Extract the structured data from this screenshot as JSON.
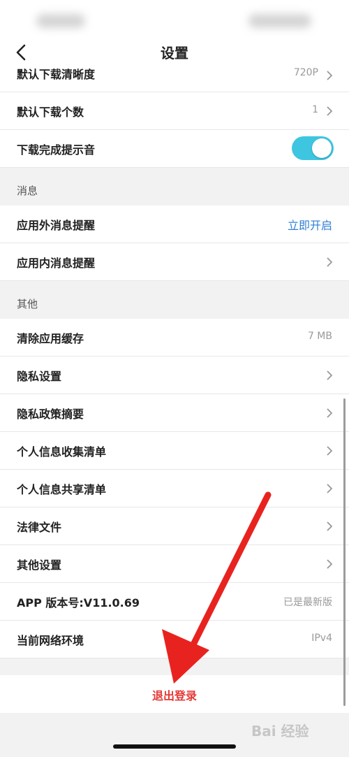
{
  "nav": {
    "title": "设置"
  },
  "download": {
    "clip_label": "默认下载清晰度",
    "clip_value": "720P",
    "count_label": "默认下载个数",
    "count_value": "1",
    "sound_label": "下载完成提示音",
    "sound_on": true
  },
  "messages": {
    "header": "消息",
    "outside_label": "应用外消息提醒",
    "outside_action": "立即开启",
    "inside_label": "应用内消息提醒"
  },
  "other": {
    "header": "其他",
    "rows": [
      {
        "label": "清除应用缓存",
        "value": "7 MB",
        "chevron": false
      },
      {
        "label": "隐私设置",
        "value": "",
        "chevron": true
      },
      {
        "label": "隐私政策摘要",
        "value": "",
        "chevron": true
      },
      {
        "label": "个人信息收集清单",
        "value": "",
        "chevron": true
      },
      {
        "label": "个人信息共享清单",
        "value": "",
        "chevron": true
      },
      {
        "label": "法律文件",
        "value": "",
        "chevron": true
      },
      {
        "label": "其他设置",
        "value": "",
        "chevron": true
      },
      {
        "label": "APP 版本号:V11.0.69",
        "value": "已是最新版",
        "chevron": false
      },
      {
        "label": "当前网络环境",
        "value": "IPv4",
        "chevron": false
      }
    ]
  },
  "logout_label": "退出登录",
  "watermark": "Bai 经验",
  "colors": {
    "accent": "#3ec6e0",
    "link": "#2f7fd6",
    "logout": "#e53935",
    "annotation_arrow": "#e8231f"
  },
  "icons": {
    "back": "chevron-left-icon",
    "row": "chevron-right-icon"
  }
}
